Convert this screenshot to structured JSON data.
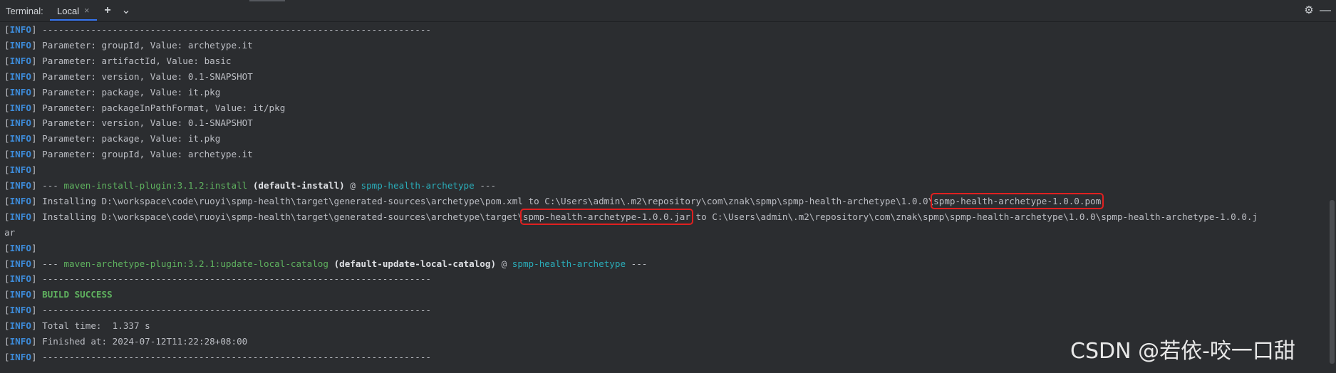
{
  "tabbar": {
    "title": "Terminal:",
    "active_tab": "Local",
    "close_glyph": "×",
    "add_glyph": "+",
    "dropdown_glyph": "⌄",
    "settings_glyph": "⚙",
    "minimize_glyph": "—"
  },
  "terminal": {
    "tag": "INFO",
    "lines": [
      "------------------------------------------------------------------------",
      "Parameter: groupId, Value: archetype.it",
      "Parameter: artifactId, Value: basic",
      "Parameter: version, Value: 0.1-SNAPSHOT",
      "Parameter: package, Value: it.pkg",
      "Parameter: packageInPathFormat, Value: it/pkg",
      "Parameter: version, Value: 0.1-SNAPSHOT",
      "Parameter: package, Value: it.pkg",
      "Parameter: groupId, Value: archetype.it",
      "",
      "",
      "",
      "",
      "",
      "",
      "",
      "------------------------------------------------------------------------",
      "",
      "------------------------------------------------------------------------",
      "Total time:  1.337 s",
      "Finished at: 2024-07-12T11:22:28+08:00",
      "------------------------------------------------------------------------"
    ],
    "install_plugin": {
      "prefix": "--- ",
      "plugin": "maven-install-plugin:3.1.2:install",
      "exec": "(default-install)",
      "at": " @ ",
      "project": "spmp-health-archetype",
      "suffix": " ---"
    },
    "install_pom": {
      "text": "Installing D:\\workspace\\code\\ruoyi\\spmp-health\\target\\generated-sources\\archetype\\pom.xml to C:\\Users\\admin\\.m2\\repository\\com\\znak\\spmp\\spmp-health-archetype\\1.0.0\\",
      "highlight": "spmp-health-archetype-1.0.0.pom"
    },
    "install_jar": {
      "before": "Installing D:\\workspace\\code\\ruoyi\\spmp-health\\target\\generated-sources\\archetype\\target\\",
      "highlight": "spmp-health-archetype-1.0.0.jar",
      "after": " to C:\\Users\\admin\\.m2\\repository\\com\\znak\\spmp\\spmp-health-archetype\\1.0.0\\spmp-health-archetype-1.0.0.j",
      "wrap": "ar"
    },
    "archetype_plugin": {
      "prefix": "--- ",
      "plugin": "maven-archetype-plugin:3.2.1:update-local-catalog",
      "exec": "(default-update-local-catalog)",
      "at": " @ ",
      "project": "spmp-health-archetype",
      "suffix": " ---"
    },
    "build_success": "BUILD SUCCESS"
  },
  "watermark": "CSDN @若依-咬一口甜",
  "colors": {
    "background": "#2b2d30",
    "info_tag": "#3d8bd9",
    "plugin_green": "#5fb25f",
    "project_teal": "#2aacb8",
    "highlight_box": "#e02020"
  }
}
